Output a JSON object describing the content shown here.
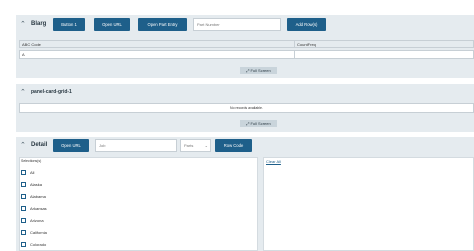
{
  "panel1": {
    "title": "Blarg",
    "buttons": [
      "Button 1",
      "Open URL",
      "Open Part Entry",
      "Add Row(s)"
    ],
    "part_number_placeholder": "Part Number",
    "grid": {
      "columns": [
        "ABC Code",
        "CountFreq"
      ],
      "row": [
        "A",
        ""
      ]
    },
    "fullscreen_label": "Full Screen"
  },
  "panel2": {
    "title": "panel-card-grid-1",
    "empty_text": "No records available.",
    "fullscreen_label": "Full Screen"
  },
  "panel3": {
    "title": "Detail",
    "open_url_label": "Open URL",
    "job_placeholder": "Job",
    "select_value": "Parts",
    "row_code_label": "Row Code",
    "list_header": "Selections(s)",
    "clear_all_label": "Clear All",
    "items": [
      "All",
      "Alaska",
      "Alabama",
      "Arkansas",
      "Arizona",
      "California",
      "Colorado"
    ]
  }
}
